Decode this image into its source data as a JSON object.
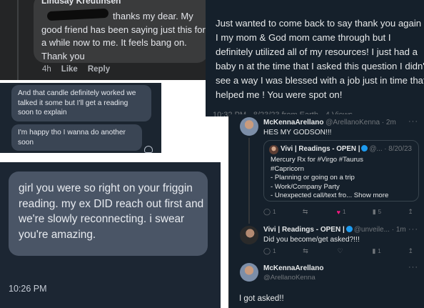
{
  "fb_comment": {
    "author": "Lindsay Kreutinsen",
    "text": "thanks my dear. My good friend has been saying just this for a while now to me. It feels bang on. Thank you",
    "time": "4h",
    "like": "Like",
    "reply": "Reply"
  },
  "messenger": {
    "msg1": "And that candle definitely worked we talked it some but I'll get a reading soon to explain",
    "msg2": "I'm happy tho I wanna do another soon"
  },
  "imessage": {
    "text": "girl you were so right on your friggin reading. my ex DID reach out first and we're slowly reconnecting. i swear you're amazing.",
    "time": "10:26 PM"
  },
  "tweet_reply": {
    "text": "Just wanted to come back to say thank you again ! I my mom & God mom came through but I definitely utilized all of my resources! I just had a baby n at the time that I asked this question I didn't see a way I was blessed with a job just in time that helped me ! You were spot on!",
    "meta": "10:32 PM · 8/23/23 from Earth · 4 Views"
  },
  "thread": {
    "tweet1": {
      "name": "McKennaArellano",
      "handle": "@ArellanoKenna · 2m",
      "text": "HES MY GODSON!!!",
      "quote": {
        "name": "Vivi | Readings - OPEN |",
        "handle": "@... · 8/20/23",
        "body": "Mercury Rx for #Virgo #Taurus\n#Capricorn\n- Planning or going on a trip\n- Work/Company Party\n- Unexpected call/text fro... ",
        "show_more": "Show more"
      },
      "actions": {
        "replies": "1",
        "retweets": "",
        "likes": "1",
        "views": "5"
      }
    },
    "tweet2": {
      "name": "Vivi | Readings - OPEN |",
      "handle": "@unveile... · 1m",
      "text": "Did you become/get asked?!!!",
      "actions": {
        "replies": "1",
        "retweets": "",
        "likes": "",
        "views": "1"
      }
    },
    "tweet3": {
      "name": "McKennaArellano",
      "handle": "@ArellanoKenna",
      "text": "I got asked!!"
    },
    "more_dots": "···"
  }
}
